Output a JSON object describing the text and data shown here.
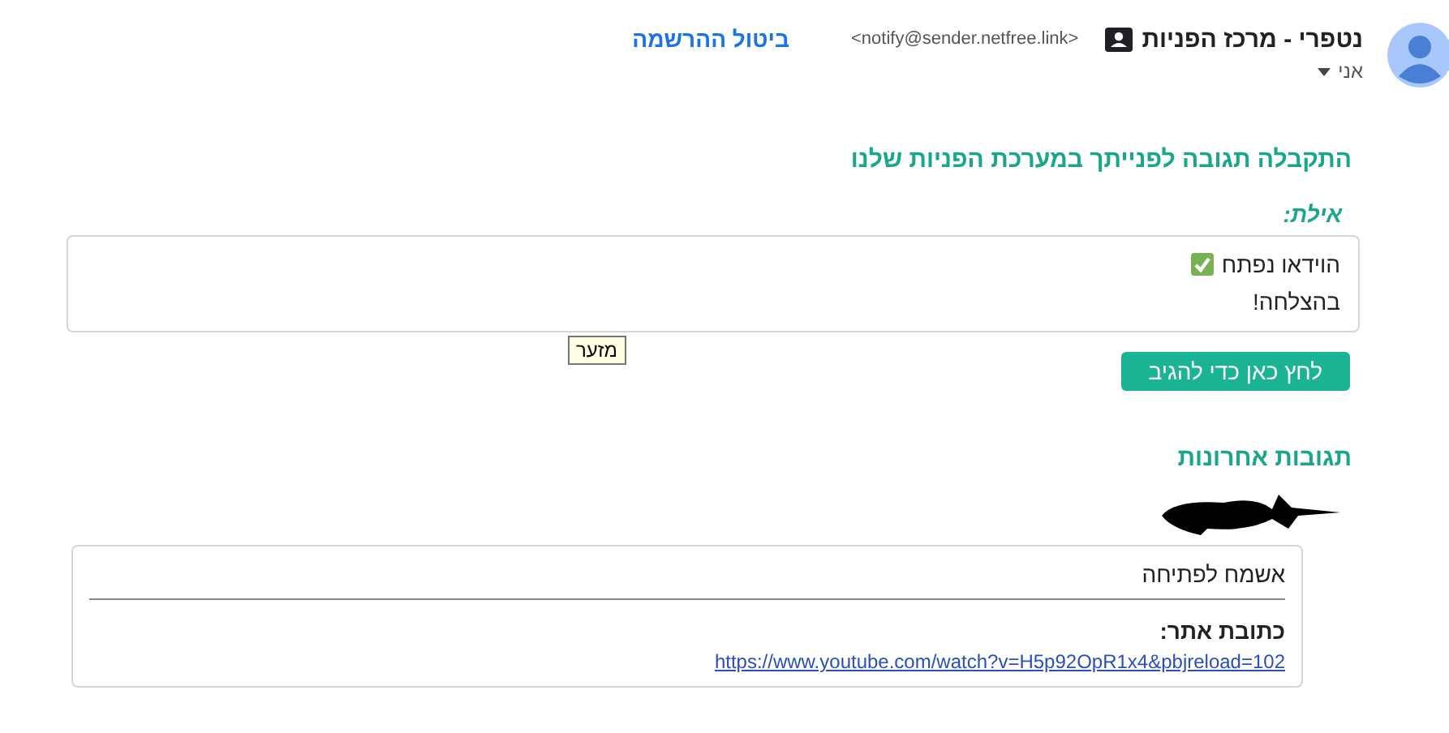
{
  "sender": {
    "name": "נטפרי - מרכז הפניות",
    "email": "<notify@sender.netfree.link>",
    "recipient": "אני"
  },
  "unsubscribe": "ביטול ההרשמה",
  "title": "התקבלה תגובה לפנייתך במערכת הפניות שלנו",
  "reply": {
    "author": "אילת:",
    "lines": [
      {
        "text": "הוידאו נפתח",
        "kind": "check"
      },
      {
        "text": "בהצלחה!"
      }
    ]
  },
  "reply_button": "לחץ כאן כדי להגיב",
  "tooltip": "מזער",
  "recent": {
    "heading": "תגובות אחרונות",
    "items": [
      {
        "message": "אשמח לפתיחה",
        "field_label": "כתובת אתר:",
        "url": "https://www.youtube.com/watch?v=H5p92OpR1x4&pbjreload=102"
      }
    ]
  }
}
